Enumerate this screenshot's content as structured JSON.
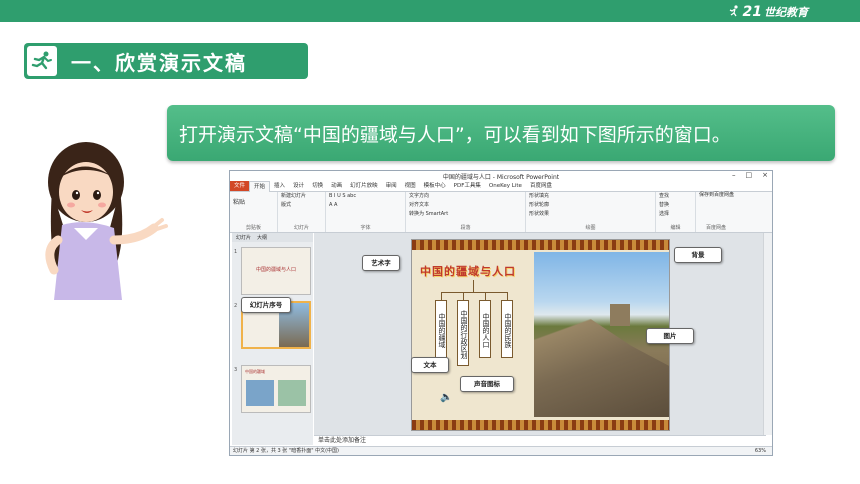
{
  "header": {
    "logo_number": "21",
    "logo_text": "世纪教育",
    "accent_color": "#2f9e6e"
  },
  "section": {
    "title": "一、欣赏演示文稿",
    "icon": "runner-icon"
  },
  "description": "打开演示文稿“中国的疆域与人口”，可以看到如下图所示的窗口。",
  "ppt_window": {
    "title": "中国的疆域与人口 - Microsoft PowerPoint",
    "tabs": [
      "文件",
      "开始",
      "插入",
      "设计",
      "切换",
      "动画",
      "幻灯片放映",
      "审阅",
      "视图",
      "模板中心",
      "PDF工具集",
      "OneKey Lite",
      "百度网盘"
    ],
    "ribbon_groups": [
      {
        "label": "剪贴板",
        "items": [
          "剪切",
          "复制",
          "格式刷"
        ],
        "big": "粘贴"
      },
      {
        "label": "幻灯片",
        "items": [
          "新建幻灯片",
          "版式",
          "重设",
          "节"
        ]
      },
      {
        "label": "字体",
        "items": [
          "B I U S abc",
          "A A"
        ]
      },
      {
        "label": "段落",
        "items": [
          "文字方向",
          "对齐文本",
          "转换为 SmartArt"
        ]
      },
      {
        "label": "绘图",
        "items": [
          "排列",
          "快速样式",
          "形状填充",
          "形状轮廓",
          "形状效果"
        ]
      },
      {
        "label": "编辑",
        "items": [
          "查找",
          "替换",
          "选择"
        ]
      },
      {
        "label": "百度网盘",
        "items": [
          "保存到百度网盘"
        ]
      }
    ],
    "left_pane_tabs": [
      "幻灯片",
      "大纲"
    ],
    "thumbnails": [
      {
        "num": "1",
        "text": "中国的疆域与人口"
      },
      {
        "num": "2",
        "text": ""
      },
      {
        "num": "3",
        "text": "中国的疆域"
      }
    ],
    "notes_placeholder": "单击此处添加备注",
    "status": "幻灯片 第 2 张，共 3 张   \"暗香扑面\"   中文(中国)",
    "zoom": "63%"
  },
  "slide": {
    "title": "中国的疆域与人口",
    "boxes": [
      "中国的疆域",
      "中国的行政区划",
      "中国的人口",
      "中国的民族"
    ]
  },
  "callouts": {
    "art_text": "艺术字",
    "background": "背景",
    "slide_order": "幻灯片序号",
    "picture": "图片",
    "text": "文本",
    "sound_icon": "声音图标"
  }
}
